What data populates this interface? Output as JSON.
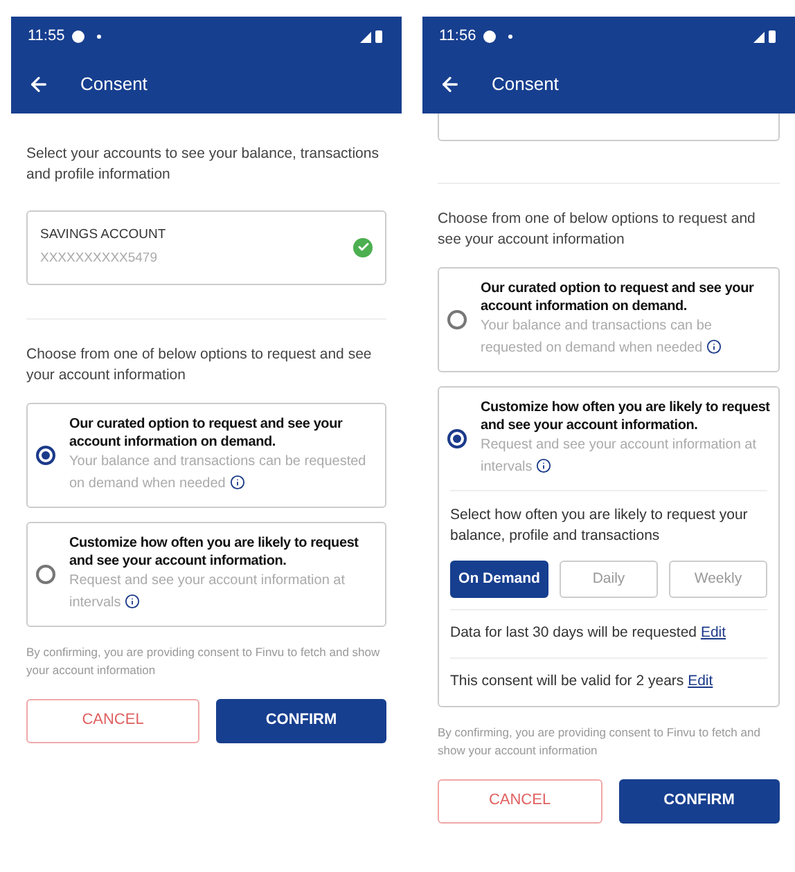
{
  "screens": [
    {
      "time": "11:55",
      "title": "Consent",
      "intro": "Select your accounts to see your balance, transactions and profile information",
      "account": {
        "type": "SAVINGS ACCOUNT",
        "number": "XXXXXXXXXX5479",
        "checked": true
      },
      "prompt": "Choose from one of below options to request and see your account information",
      "options": [
        {
          "title": "Our curated option to request and see your account information on demand.",
          "description": "Your balance and transactions can be requested on demand when needed",
          "selected": true
        },
        {
          "title": "Customize how often you are likely to request and see your account information.",
          "description": "Request and see your account information at intervals",
          "selected": false
        }
      ],
      "footer": "By confirming, you are providing consent to Finvu to fetch and show your account information",
      "buttons": [
        {
          "label": "CANCEL",
          "kind": "secondary"
        },
        {
          "label": "CONFIRM",
          "kind": "primary"
        }
      ]
    },
    {
      "time": "11:56",
      "title": "Consent",
      "account_cut_off": true,
      "prompt": "Choose from one of below options to request and see your account information",
      "options": [
        {
          "title": "Our curated option to request and see your account information on demand.",
          "description": "Your balance and transactions can be requested on demand when needed",
          "selected": false
        },
        {
          "title": "Customize how often you are likely to request and see your account information.",
          "description": "Request and see your account information at intervals",
          "selected": true,
          "frequency": {
            "prompt": "Select how often you are likely to request your balance, profile and transactions",
            "choices": [
              {
                "label": "On Demand",
                "selected": true
              },
              {
                "label": "Daily",
                "selected": false
              },
              {
                "label": "Weekly",
                "selected": false
              }
            ],
            "details": [
              {
                "text": "Data for last 30 days will be requested",
                "link": "Edit"
              },
              {
                "text": "This consent will be valid for 2 years",
                "link": "Edit"
              }
            ]
          }
        }
      ],
      "footer": "By confirming, you are providing consent to Finvu to fetch and show your account information",
      "buttons": [
        {
          "label": "CANCEL",
          "kind": "secondary"
        },
        {
          "label": "CONFIRM",
          "kind": "primary"
        }
      ]
    }
  ]
}
